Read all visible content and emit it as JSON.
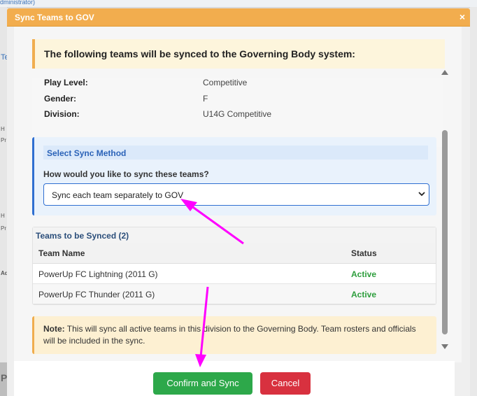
{
  "background": {
    "admin_fragment": "dministrator)",
    "left_fragments": [
      "Te",
      "H",
      "Pr",
      "H",
      "Pr",
      "Ad",
      "P"
    ]
  },
  "modal": {
    "title": "Sync Teams to GOV",
    "close_label": "×",
    "intro": "The following teams will be synced to the Governing Body system:",
    "info": [
      {
        "label": "Play Level:",
        "value": "Competitive"
      },
      {
        "label": "Gender:",
        "value": "F"
      },
      {
        "label": "Division:",
        "value": "U14G Competitive"
      }
    ],
    "sync_method": {
      "title": "Select Sync Method",
      "question": "How would you like to sync these teams?",
      "selected": "Sync each team separately to GOV"
    },
    "teams": {
      "title": "Teams to be Synced (2)",
      "columns": [
        "Team Name",
        "Status"
      ],
      "rows": [
        {
          "name": "PowerUp FC Lightning (2011 G)",
          "status": "Active"
        },
        {
          "name": "PowerUp FC Thunder (2011 G)",
          "status": "Active"
        }
      ]
    },
    "note": {
      "strong": "Note:",
      "text": " This will sync all active teams in this division to the Governing Body. Team rosters and officials will be included in the sync."
    },
    "buttons": {
      "confirm": "Confirm and Sync",
      "cancel": "Cancel"
    }
  },
  "colors": {
    "header": "#f2ad4e",
    "confirm": "#2da84a",
    "cancel": "#d8313f",
    "status_active": "#2e9e3d",
    "annotation_arrow": "#ff00ff"
  }
}
